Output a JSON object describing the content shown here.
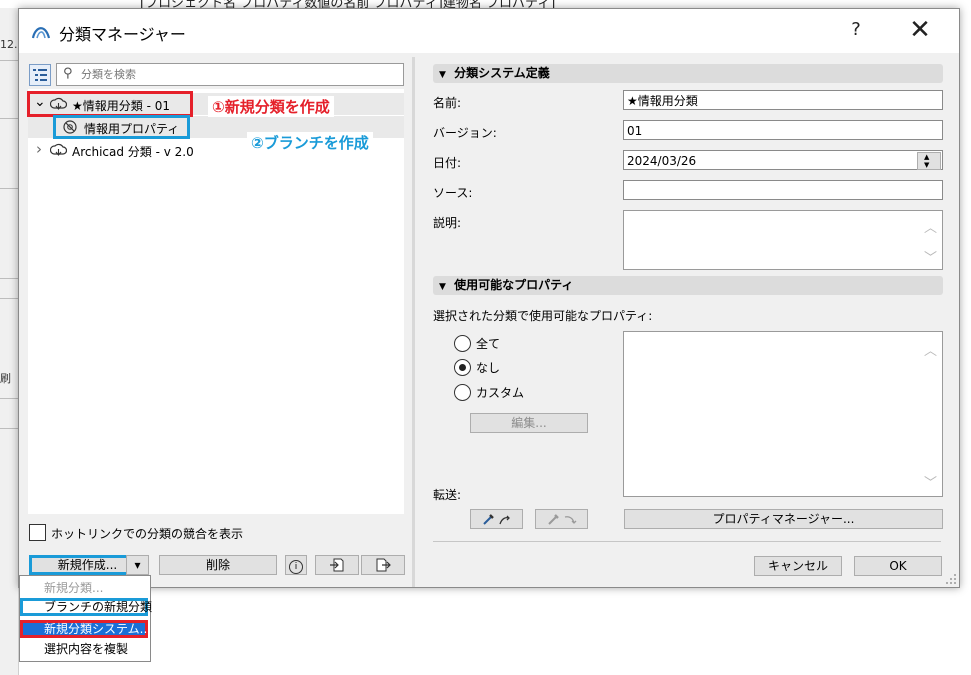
{
  "background": {
    "title_text": "[プロジェクト名 プロパティ数値の名前 プロパティ]建物名 プロパティ]",
    "left_texts": [
      "12.",
      "刷"
    ]
  },
  "dialog": {
    "title": "分類マネージャー",
    "help_glyph": "?",
    "close_glyph": "✕"
  },
  "left": {
    "search_placeholder": "分類を検索",
    "tree": [
      {
        "label": "★情報用分類 - 01",
        "expander": "⌄"
      },
      {
        "label": "情報用プロパティ"
      },
      {
        "label": "Archicad 分類 - v 2.0",
        "expander": "›"
      }
    ],
    "annotations": {
      "red": "①新規分類を作成",
      "blue": "②ブランチを作成"
    },
    "hotlink_checkbox_label": "ホットリンクでの分類の競合を表示",
    "new_button": "新規作成...",
    "delete_button": "削除",
    "menu": {
      "items": [
        "新規分類...",
        "ブランチの新規分類",
        "新規分類システム...",
        "選択内容を複製"
      ]
    }
  },
  "right": {
    "section1_title": "分類システム定義",
    "name_label": "名前:",
    "name_value": "★情報用分類",
    "version_label": "バージョン:",
    "version_value": "01",
    "date_label": "日付:",
    "date_value": "2024/03/26",
    "source_label": "ソース:",
    "source_value": "",
    "description_label": "説明:",
    "section2_title": "使用可能なプロパティ",
    "available_label": "選択された分類で使用可能なプロパティ:",
    "radios": [
      "全て",
      "なし",
      "カスタム"
    ],
    "selected_radio": "なし",
    "edit_button": "編集...",
    "transfer_label": "転送:",
    "property_manager_button": "プロパティマネージャー...",
    "cancel_button": "キャンセル",
    "ok_button": "OK"
  },
  "colors": {
    "annotation_red": "#e5202a",
    "annotation_blue": "#1a9bd8",
    "menu_highlight": "#1a6fd6"
  }
}
